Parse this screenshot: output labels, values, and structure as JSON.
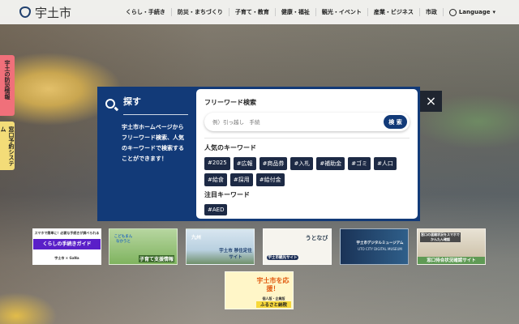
{
  "header": {
    "logo": "宇土市",
    "nav": [
      "くらし・手続き",
      "防災・まちづくり",
      "子育て・教育",
      "健康・福祉",
      "観光・イベント",
      "産業・ビジネス",
      "市政"
    ],
    "language": "Language"
  },
  "side_tabs": [
    "宇土の防災情報",
    "窓口予約システム"
  ],
  "search_modal": {
    "title": "探す",
    "description": "宇土市ホームページからフリーワード検索、人気のキーワードで検索することができます！",
    "free_word_label": "フリーワード検索",
    "placeholder": "例）引っ越し　手続",
    "search_button": "検 索",
    "popular_label": "人気のキーワード",
    "popular": [
      "#2025",
      "#広報",
      "#商品券",
      "#入札",
      "#補助金",
      "#ゴミ",
      "#人口",
      "#給食",
      "#採用",
      "#給付金"
    ],
    "featured_label": "注目キーワード",
    "featured": [
      "#AED"
    ],
    "close": "×"
  },
  "banners": [
    {
      "top": "スマホで簡単に！必要な手続きが調べられる",
      "main": "くらしの手続きガイド",
      "bottom": "宇土市 × GaNa"
    },
    {
      "top": "こどもまんなかうと",
      "main": "子育て支援情報"
    },
    {
      "top": "九州",
      "main": "宇土市 移住定住サイト"
    },
    {
      "top": "うとなび",
      "main": "宇土市観光サイト"
    },
    {
      "top": "宇土市デジタルミュージアム",
      "main": "UTO CITY DIGITAL MUSEUM"
    },
    {
      "top": "窓口の混雑状況をスマホでかんたん確認",
      "main": "窓口待合状況確認サイト"
    },
    {
      "top": "宇土市を応援！",
      "main": "ふるさと納税",
      "sub": "個人版・企業版"
    }
  ]
}
